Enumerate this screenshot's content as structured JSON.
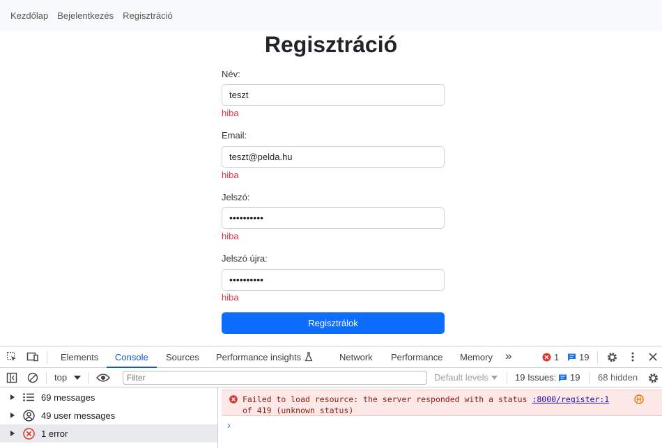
{
  "nav": {
    "links": [
      "Kezdőlap",
      "Bejelentkezés",
      "Regisztráció"
    ]
  },
  "page": {
    "title": "Regisztráció",
    "fields": [
      {
        "label": "Név:",
        "value": "teszt",
        "error": "hiba"
      },
      {
        "label": "Email:",
        "value": "teszt@pelda.hu",
        "error": "hiba"
      },
      {
        "label": "Jelszó:",
        "value": "••••••••••",
        "error": "hiba"
      },
      {
        "label": "Jelszó újra:",
        "value": "••••••••••",
        "error": "hiba"
      }
    ],
    "submit_label": "Regisztrálok"
  },
  "devtools": {
    "tabs": [
      "Elements",
      "Console",
      "Sources",
      "Performance insights",
      "Network",
      "Performance",
      "Memory"
    ],
    "active_tab": "Console",
    "more_tabs": "»",
    "error_count": "1",
    "issue_count": "19",
    "toolbar": {
      "context": "top",
      "filter_placeholder": "Filter",
      "levels": "Default levels",
      "issues_label": "19 Issues:",
      "issues_count": "19",
      "hidden": "68 hidden"
    },
    "sidebar": [
      {
        "label": "69 messages",
        "icon": "list-icon"
      },
      {
        "label": "49 user messages",
        "icon": "user-icon"
      },
      {
        "label": "1 error",
        "icon": "error-icon"
      }
    ],
    "console": {
      "error_text_1": "Failed to load resource: the server responded with a status",
      "error_link": ":8000/register:1",
      "error_text_2": "of 419 (unknown status)",
      "prompt": "›"
    }
  },
  "colors": {
    "accent": "#0d6efd",
    "error": "#dc3545",
    "devtools_active": "#0b57d0",
    "error_bg": "#fce8e6"
  }
}
